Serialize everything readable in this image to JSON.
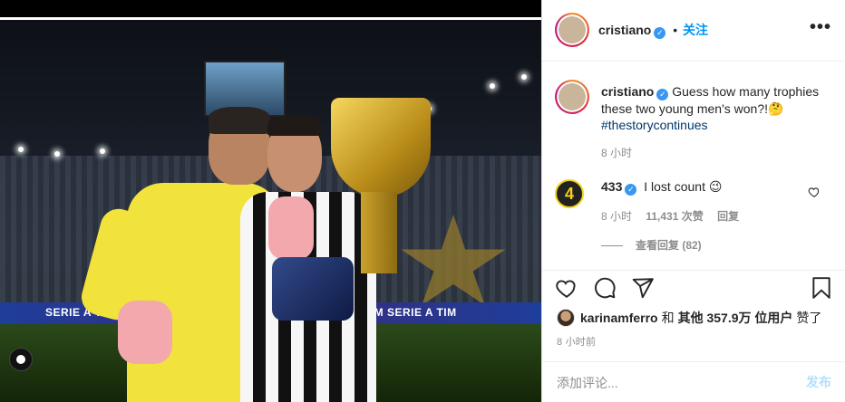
{
  "post": {
    "author": "cristiano",
    "follow_label": "关注",
    "dot": "•",
    "more": "•••"
  },
  "photo": {
    "band_text_1": "SERIE A TIM",
    "band_text_2": "I M  SERIE A TIM"
  },
  "caption": {
    "username": "cristiano",
    "text": "Guess how many trophies these two young men's won?!🤔",
    "hashtag": "#thestorycontinues",
    "time": "8 小时"
  },
  "comment": {
    "avatar_text": "4",
    "username": "433",
    "text": "I lost count 😉",
    "time": "8 小时",
    "likes": "11,431 次赞",
    "reply": "回复",
    "view_replies": "查看回复 (82)"
  },
  "likes": {
    "user": "karinamferro",
    "joiner": "和",
    "others": "其他 357.9万 位用户",
    "suffix": "赞了"
  },
  "post_time": "8 小时前",
  "comment_box": {
    "placeholder": "添加评论...",
    "post_label": "发布"
  },
  "colors": {
    "link_blue": "#0095f6",
    "verified_blue": "#3897f0",
    "muted": "#8e8e8e",
    "text": "#262626"
  }
}
